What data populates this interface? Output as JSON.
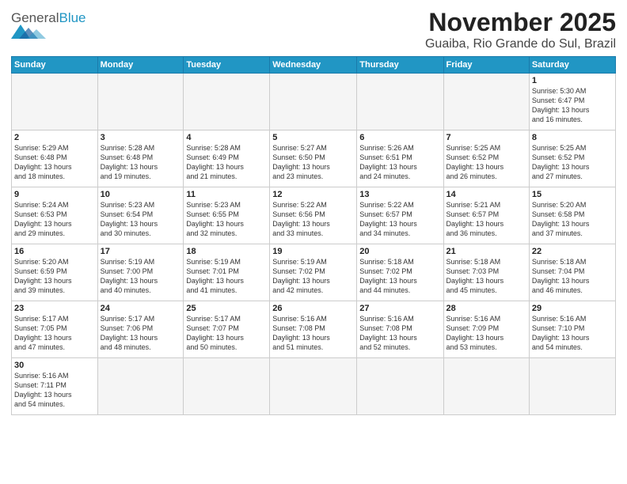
{
  "header": {
    "logo_general": "General",
    "logo_blue": "Blue",
    "month": "November 2025",
    "location": "Guaiba, Rio Grande do Sul, Brazil"
  },
  "weekdays": [
    "Sunday",
    "Monday",
    "Tuesday",
    "Wednesday",
    "Thursday",
    "Friday",
    "Saturday"
  ],
  "weeks": [
    [
      {
        "day": "",
        "info": ""
      },
      {
        "day": "",
        "info": ""
      },
      {
        "day": "",
        "info": ""
      },
      {
        "day": "",
        "info": ""
      },
      {
        "day": "",
        "info": ""
      },
      {
        "day": "",
        "info": ""
      },
      {
        "day": "1",
        "info": "Sunrise: 5:30 AM\nSunset: 6:47 PM\nDaylight: 13 hours\nand 16 minutes."
      }
    ],
    [
      {
        "day": "2",
        "info": "Sunrise: 5:29 AM\nSunset: 6:48 PM\nDaylight: 13 hours\nand 18 minutes."
      },
      {
        "day": "3",
        "info": "Sunrise: 5:28 AM\nSunset: 6:48 PM\nDaylight: 13 hours\nand 19 minutes."
      },
      {
        "day": "4",
        "info": "Sunrise: 5:28 AM\nSunset: 6:49 PM\nDaylight: 13 hours\nand 21 minutes."
      },
      {
        "day": "5",
        "info": "Sunrise: 5:27 AM\nSunset: 6:50 PM\nDaylight: 13 hours\nand 23 minutes."
      },
      {
        "day": "6",
        "info": "Sunrise: 5:26 AM\nSunset: 6:51 PM\nDaylight: 13 hours\nand 24 minutes."
      },
      {
        "day": "7",
        "info": "Sunrise: 5:25 AM\nSunset: 6:52 PM\nDaylight: 13 hours\nand 26 minutes."
      },
      {
        "day": "8",
        "info": "Sunrise: 5:25 AM\nSunset: 6:52 PM\nDaylight: 13 hours\nand 27 minutes."
      }
    ],
    [
      {
        "day": "9",
        "info": "Sunrise: 5:24 AM\nSunset: 6:53 PM\nDaylight: 13 hours\nand 29 minutes."
      },
      {
        "day": "10",
        "info": "Sunrise: 5:23 AM\nSunset: 6:54 PM\nDaylight: 13 hours\nand 30 minutes."
      },
      {
        "day": "11",
        "info": "Sunrise: 5:23 AM\nSunset: 6:55 PM\nDaylight: 13 hours\nand 32 minutes."
      },
      {
        "day": "12",
        "info": "Sunrise: 5:22 AM\nSunset: 6:56 PM\nDaylight: 13 hours\nand 33 minutes."
      },
      {
        "day": "13",
        "info": "Sunrise: 5:22 AM\nSunset: 6:57 PM\nDaylight: 13 hours\nand 34 minutes."
      },
      {
        "day": "14",
        "info": "Sunrise: 5:21 AM\nSunset: 6:57 PM\nDaylight: 13 hours\nand 36 minutes."
      },
      {
        "day": "15",
        "info": "Sunrise: 5:20 AM\nSunset: 6:58 PM\nDaylight: 13 hours\nand 37 minutes."
      }
    ],
    [
      {
        "day": "16",
        "info": "Sunrise: 5:20 AM\nSunset: 6:59 PM\nDaylight: 13 hours\nand 39 minutes."
      },
      {
        "day": "17",
        "info": "Sunrise: 5:19 AM\nSunset: 7:00 PM\nDaylight: 13 hours\nand 40 minutes."
      },
      {
        "day": "18",
        "info": "Sunrise: 5:19 AM\nSunset: 7:01 PM\nDaylight: 13 hours\nand 41 minutes."
      },
      {
        "day": "19",
        "info": "Sunrise: 5:19 AM\nSunset: 7:02 PM\nDaylight: 13 hours\nand 42 minutes."
      },
      {
        "day": "20",
        "info": "Sunrise: 5:18 AM\nSunset: 7:02 PM\nDaylight: 13 hours\nand 44 minutes."
      },
      {
        "day": "21",
        "info": "Sunrise: 5:18 AM\nSunset: 7:03 PM\nDaylight: 13 hours\nand 45 minutes."
      },
      {
        "day": "22",
        "info": "Sunrise: 5:18 AM\nSunset: 7:04 PM\nDaylight: 13 hours\nand 46 minutes."
      }
    ],
    [
      {
        "day": "23",
        "info": "Sunrise: 5:17 AM\nSunset: 7:05 PM\nDaylight: 13 hours\nand 47 minutes."
      },
      {
        "day": "24",
        "info": "Sunrise: 5:17 AM\nSunset: 7:06 PM\nDaylight: 13 hours\nand 48 minutes."
      },
      {
        "day": "25",
        "info": "Sunrise: 5:17 AM\nSunset: 7:07 PM\nDaylight: 13 hours\nand 50 minutes."
      },
      {
        "day": "26",
        "info": "Sunrise: 5:16 AM\nSunset: 7:08 PM\nDaylight: 13 hours\nand 51 minutes."
      },
      {
        "day": "27",
        "info": "Sunrise: 5:16 AM\nSunset: 7:08 PM\nDaylight: 13 hours\nand 52 minutes."
      },
      {
        "day": "28",
        "info": "Sunrise: 5:16 AM\nSunset: 7:09 PM\nDaylight: 13 hours\nand 53 minutes."
      },
      {
        "day": "29",
        "info": "Sunrise: 5:16 AM\nSunset: 7:10 PM\nDaylight: 13 hours\nand 54 minutes."
      }
    ],
    [
      {
        "day": "30",
        "info": "Sunrise: 5:16 AM\nSunset: 7:11 PM\nDaylight: 13 hours\nand 54 minutes."
      },
      {
        "day": "",
        "info": ""
      },
      {
        "day": "",
        "info": ""
      },
      {
        "day": "",
        "info": ""
      },
      {
        "day": "",
        "info": ""
      },
      {
        "day": "",
        "info": ""
      },
      {
        "day": "",
        "info": ""
      }
    ]
  ]
}
